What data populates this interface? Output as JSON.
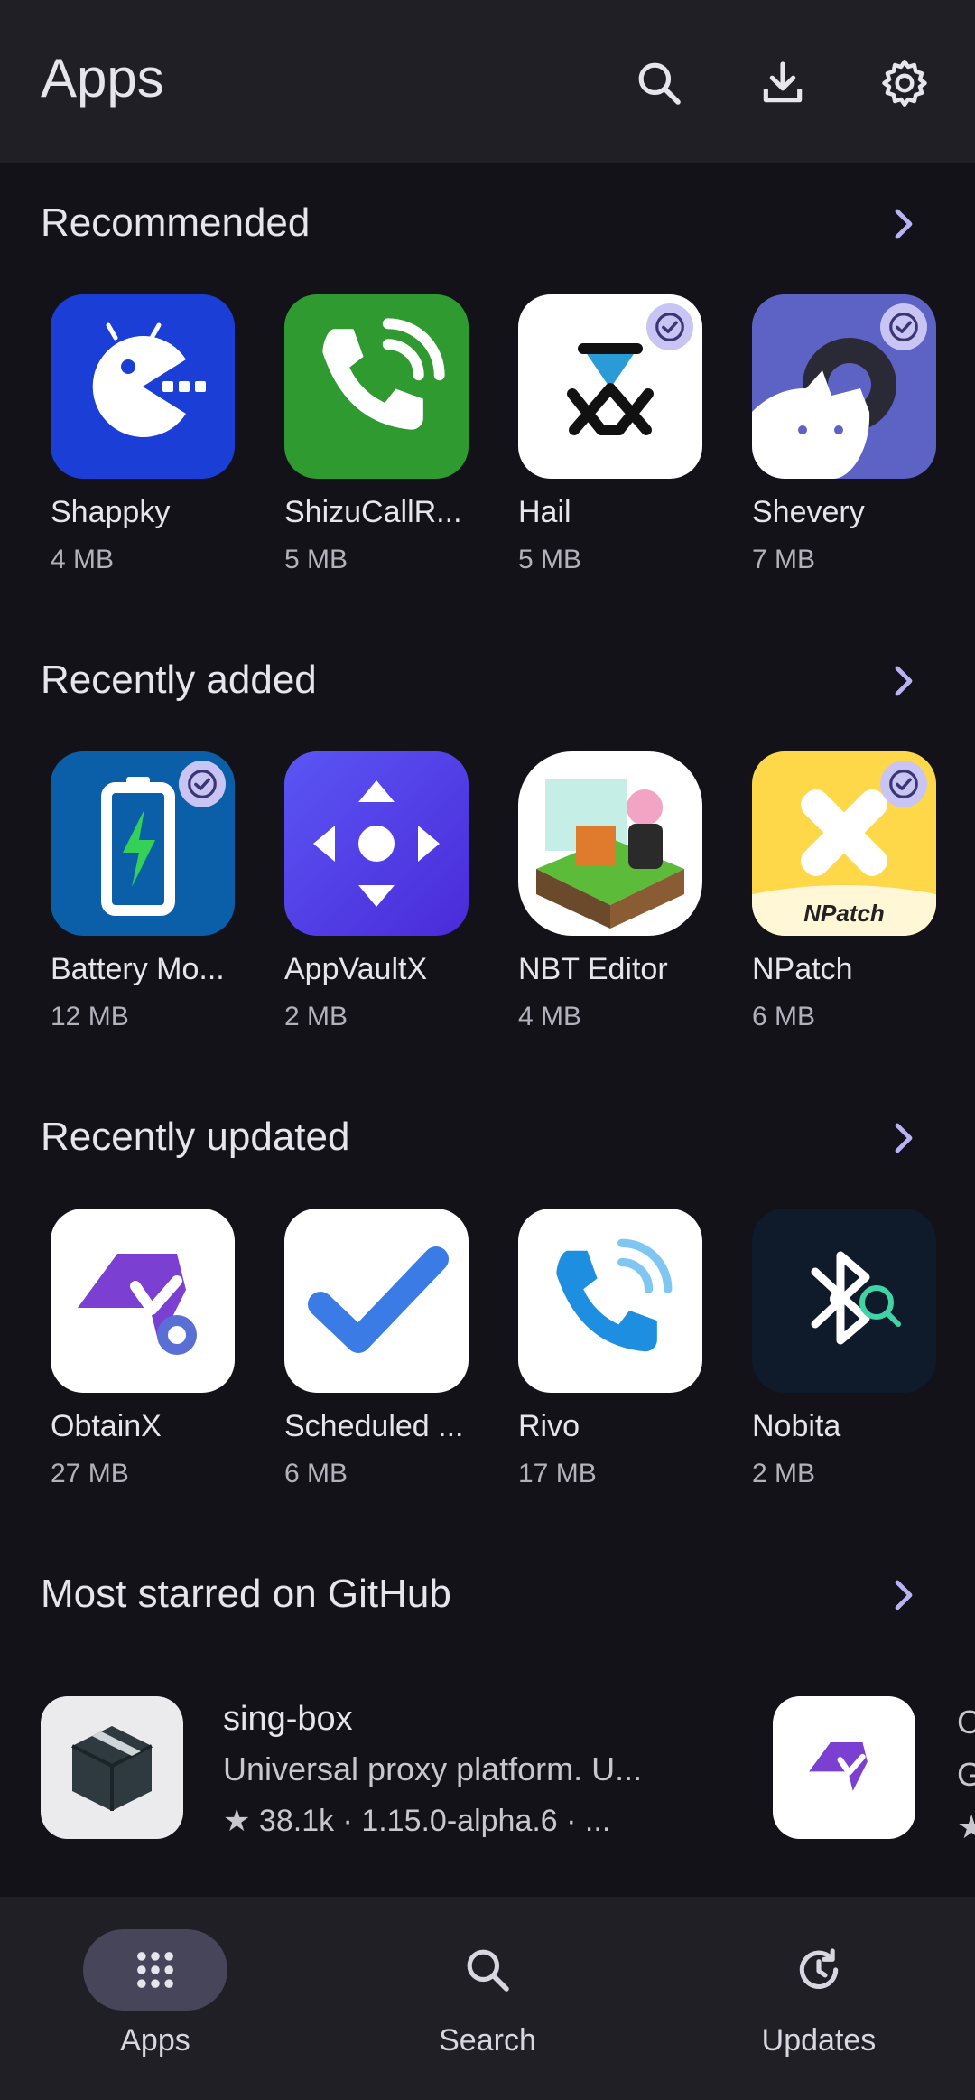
{
  "header": {
    "title": "Apps"
  },
  "sections": [
    {
      "title": "Recommended",
      "items": [
        {
          "name": "Shappky",
          "size": "4 MB",
          "color": "#1b3fd6",
          "verified": false
        },
        {
          "name": "ShizuCallR...",
          "size": "5 MB",
          "color": "#2f9a2f",
          "verified": false
        },
        {
          "name": "Hail",
          "size": "5 MB",
          "color": "#ffffff",
          "verified": true
        },
        {
          "name": "Shevery",
          "size": "7 MB",
          "color": "#5d63c4",
          "verified": true
        }
      ]
    },
    {
      "title": "Recently added",
      "items": [
        {
          "name": "Battery Mo...",
          "size": "12 MB",
          "color": "#0b5ea8",
          "verified": true
        },
        {
          "name": "AppVaultX",
          "size": "2 MB",
          "color": "#5a3cf0",
          "verified": false
        },
        {
          "name": "NBT Editor",
          "size": "4 MB",
          "color": "#ffffff",
          "verified": false
        },
        {
          "name": "NPatch",
          "size": "6 MB",
          "color": "#ffd84a",
          "verified": true,
          "icon_text": "NPatch"
        }
      ]
    },
    {
      "title": "Recently updated",
      "items": [
        {
          "name": "ObtainX",
          "size": "27 MB",
          "color": "#ffffff",
          "verified": false
        },
        {
          "name": "Scheduled ...",
          "size": "6 MB",
          "color": "#ffffff",
          "verified": false
        },
        {
          "name": "Rivo",
          "size": "17 MB",
          "color": "#ffffff",
          "verified": false
        },
        {
          "name": "Nobita",
          "size": "2 MB",
          "color": "#0f1a2b",
          "verified": false
        }
      ]
    },
    {
      "title": "Most starred on GitHub"
    }
  ],
  "github": {
    "repo": {
      "name": "sing-box",
      "description": "Universal proxy platform. U...",
      "meta": "★ 38.1k  ·  1.15.0-alpha.6  ·  ..."
    },
    "next_repo_partial": {
      "line1": "C",
      "line2": "G",
      "line3": "★"
    }
  },
  "nav": [
    {
      "label": "Apps",
      "icon": "apps-grid-icon",
      "active": true
    },
    {
      "label": "Search",
      "icon": "search-icon",
      "active": false
    },
    {
      "label": "Updates",
      "icon": "updates-icon",
      "active": false
    }
  ],
  "colors": {
    "background": "#121218",
    "surface": "#1f1f25",
    "accent": "#b9b3f5"
  }
}
